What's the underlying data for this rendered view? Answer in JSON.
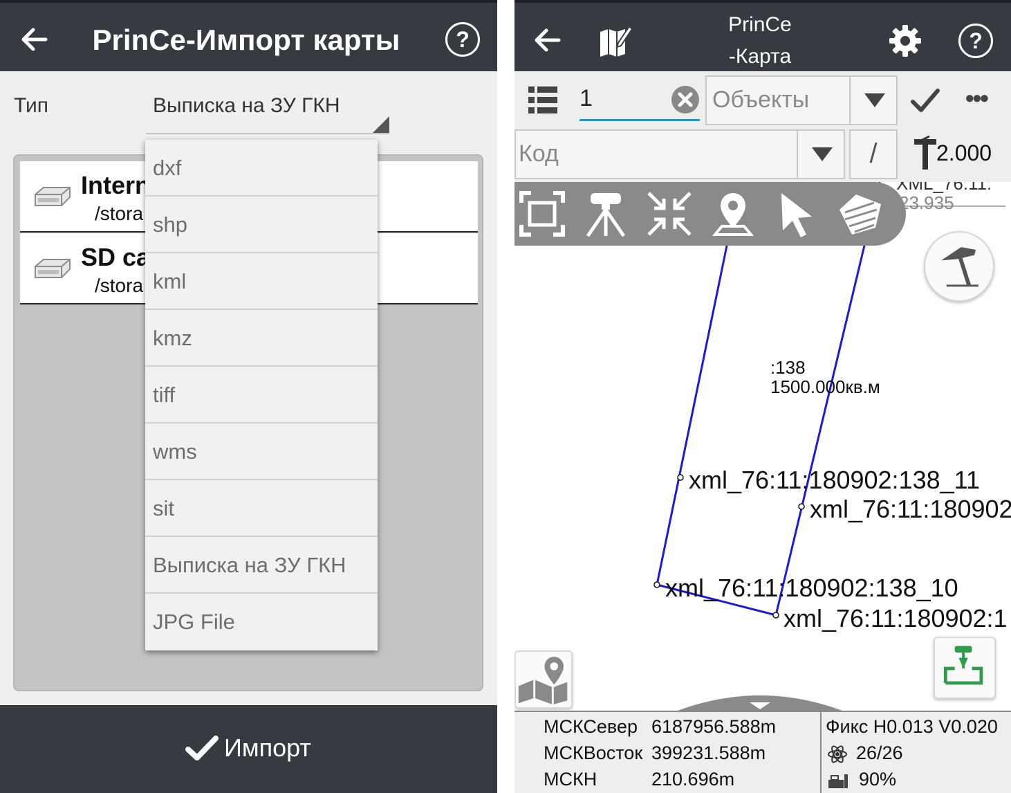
{
  "left": {
    "title": "PrinCe-Импорт карты",
    "help": "?",
    "type_label": "Тип",
    "type_value": "Выписка на ЗУ ГКН",
    "storage": [
      {
        "name": "Intern",
        "path": "/stora"
      },
      {
        "name": "SD ca",
        "path": "/stora"
      }
    ],
    "dropdown": [
      "dxf",
      "shp",
      "kml",
      "kmz",
      "tiff",
      "wms",
      "sit",
      "Выписка на ЗУ ГКН",
      "JPG File"
    ],
    "import_label": "Импорт"
  },
  "right": {
    "title_line1": "PrinCe",
    "title_line2": "-Карта",
    "help": "?",
    "number_value": "1",
    "objects_label": "Объекты",
    "more": "•••",
    "code_label": "Код",
    "slash": "/",
    "pole_height": "2.000",
    "map": {
      "partial_top_1": "XML_76:11:",
      "partial_top_2": "23.935",
      "parcel_id": ":138",
      "parcel_area": "1500.000кв.м",
      "points": [
        "xml_76:11:180902:138_11",
        "xml_76:11:180902",
        "xml_76:11:180902:138_10",
        "xml_76:11:180902:1"
      ]
    },
    "status": {
      "north_label": "МСКСевер",
      "north_value": "6187956.588m",
      "east_label": "МСКВосток",
      "east_value": "399231.588m",
      "height_label": "МСКН",
      "height_value": "210.696m",
      "fix": "Фикс H0.013 V0.020",
      "satellites": "26/26",
      "battery": "90%"
    }
  },
  "colors": {
    "header": "#353b41",
    "parcel_line": "#1a1adf",
    "accent_underline": "#2a93c7",
    "stakeout_green": "#2e9c4a"
  }
}
